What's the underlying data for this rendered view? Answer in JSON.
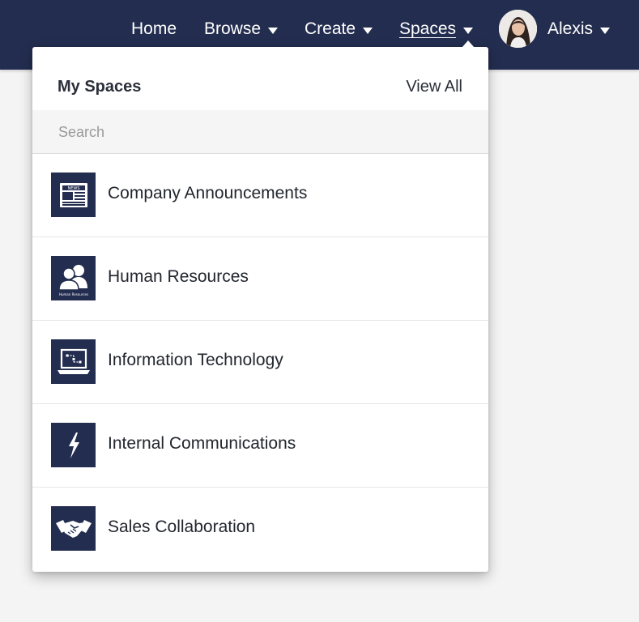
{
  "colors": {
    "topbar": "#232d4f",
    "icon_bg": "#232d4f",
    "text": "#22262e"
  },
  "nav": {
    "home": "Home",
    "browse": "Browse",
    "create": "Create",
    "spaces": "Spaces",
    "user": "Alexis"
  },
  "dropdown": {
    "title": "My Spaces",
    "view_all": "View All",
    "search_placeholder": "Search",
    "search_value": "",
    "items": [
      {
        "label": "Company Announcements",
        "icon": "newspaper-icon",
        "icon_text": "NEWS"
      },
      {
        "label": "Human Resources",
        "icon": "people-icon",
        "icon_text": "Human Resources"
      },
      {
        "label": "Information Technology",
        "icon": "laptop-icon"
      },
      {
        "label": "Internal Communications",
        "icon": "lightning-icon"
      },
      {
        "label": "Sales Collaboration",
        "icon": "handshake-icon"
      }
    ]
  }
}
